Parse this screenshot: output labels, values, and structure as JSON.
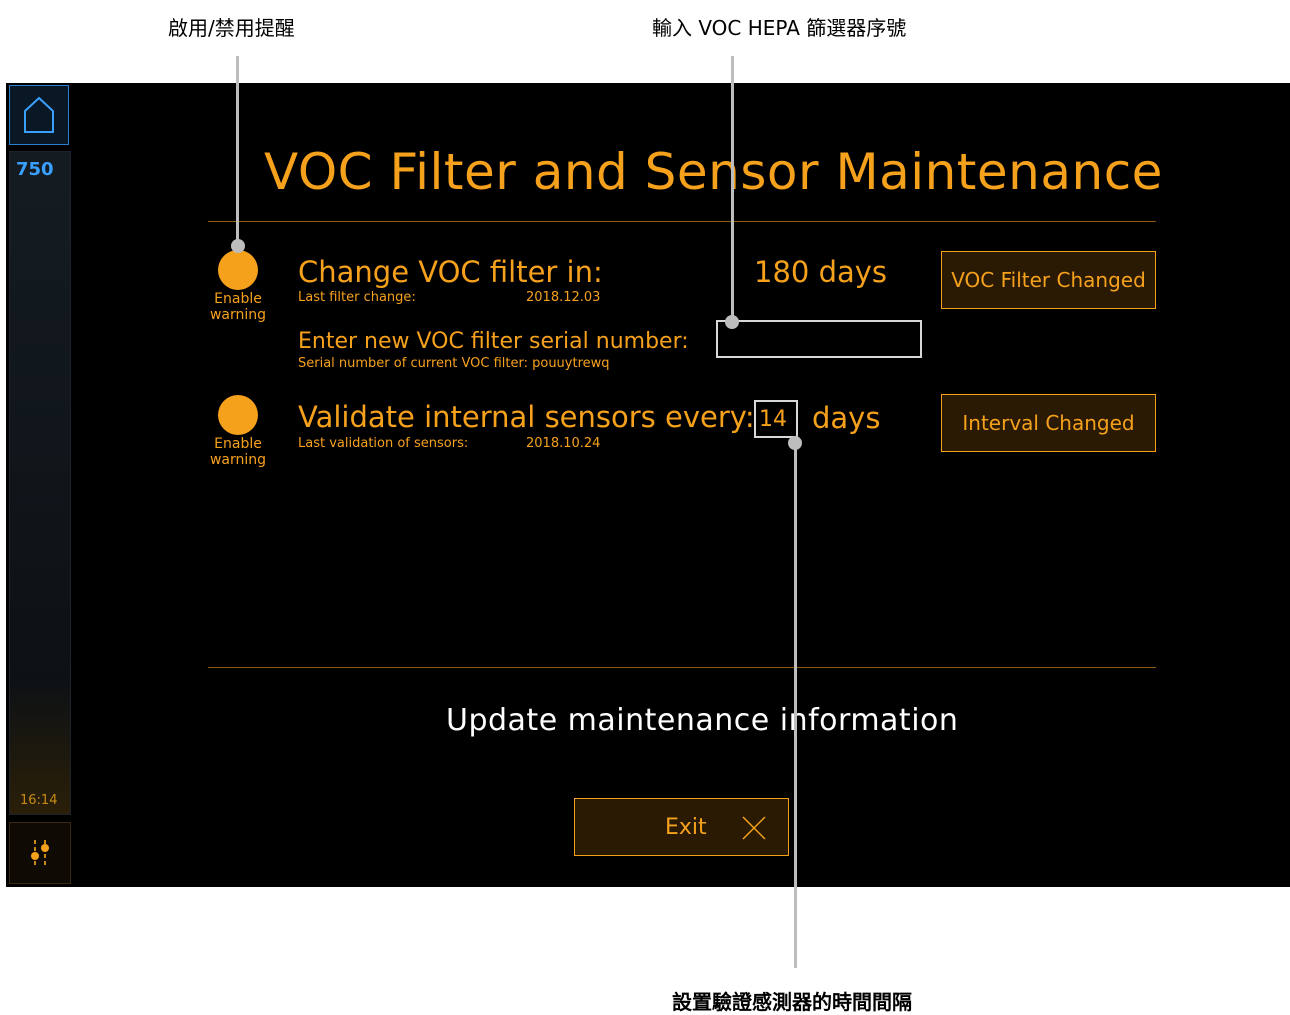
{
  "callouts": {
    "enable_disable_warning": "啟用/禁用提醒",
    "enter_serial": "輸入 VOC HEPA 篩選器序號",
    "set_interval": "設置驗證感測器的時間間隔"
  },
  "sidebar": {
    "home_icon": "home-icon",
    "counter": "750",
    "clock": "16:14",
    "settings_icon": "sliders-icon"
  },
  "screen": {
    "title": "VOC Filter and Sensor Maintenance",
    "filter": {
      "warning_label": "Enable warning",
      "title": "Change VOC filter in:",
      "last_change_label": "Last filter change:",
      "last_change_date": "2018.12.03",
      "days": "180 days",
      "button": "VOC Filter Changed",
      "serial_title": "Enter new VOC filter serial number:",
      "serial_current": "Serial number of current VOC filter: pouuytrewq",
      "serial_value": ""
    },
    "sensors": {
      "warning_label": "Enable warning",
      "title": "Validate internal sensors every:",
      "interval_value": "14",
      "days_unit": "days",
      "last_validation_label": "Last validation of sensors:",
      "last_validation_date": "2018.10.24",
      "button": "Interval Changed"
    },
    "update_info": "Update maintenance information",
    "exit": "Exit"
  },
  "colors": {
    "accent": "#f6a11c",
    "background": "#000000",
    "blue": "#3aa0ff"
  }
}
